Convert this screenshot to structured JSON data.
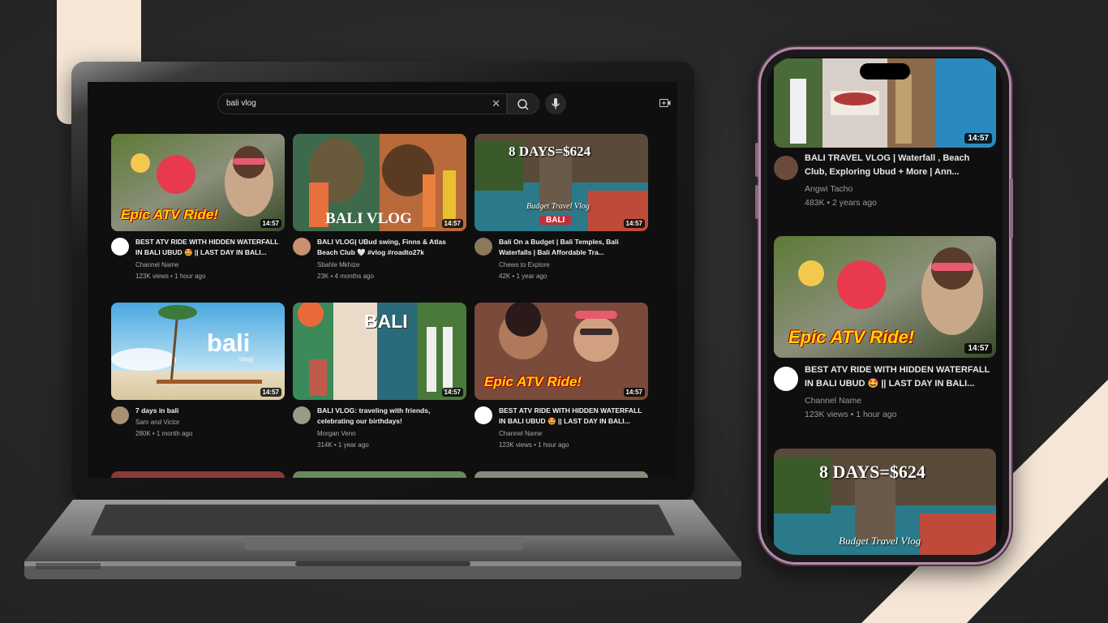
{
  "desktop": {
    "search": {
      "query": "bali vlog"
    },
    "videos": [
      {
        "title": "BEST ATV RIDE WITH HIDDEN WATERFALL IN BALI UBUD 🤩 || LAST DAY IN BALI...",
        "channel": "Channel Name",
        "stats": "123K views • 1 hour ago",
        "duration": "14:57",
        "thumb_text": "Epic ATV Ride!"
      },
      {
        "title": "BALI VLOG| UBud swing, Finns & Atlas Beach Club 🤍 #vlog #roadto27k",
        "channel": "Sbahle Mkhize",
        "stats": "23K • 4 months ago",
        "duration": "14:57",
        "thumb_text": "BALI VLOG"
      },
      {
        "title": "Bali On a Budget | Bali Temples, Bali Waterfalls | Bali Affordable Tra...",
        "channel": "Chews to Explore",
        "stats": "42K • 1 year ago",
        "duration": "14:57",
        "thumb_text": "8 DAYS=$624",
        "thumb_subtext": "Budget Travel Vlog",
        "thumb_badge": "BALI"
      },
      {
        "title": "7 days in bali",
        "channel": "Sam and Victor",
        "stats": "280K • 1 month ago",
        "duration": "14:57",
        "thumb_text": "bali",
        "thumb_subtext": "(vlog)"
      },
      {
        "title": "BALI VLOG: traveling with friends, celebrating our birthdays!",
        "channel": "Morgan Venn",
        "stats": "314K • 1 year ago",
        "duration": "14:57",
        "thumb_text": "BALI"
      },
      {
        "title": "BEST ATV RIDE WITH HIDDEN WATERFALL IN BALI UBUD 🤩 || LAST DAY IN BALI...",
        "channel": "Channel Name",
        "stats": "123K views • 1 hour ago",
        "duration": "14:57",
        "thumb_text": "Epic ATV Ride!"
      }
    ]
  },
  "mobile": {
    "videos": [
      {
        "title": "BALI TRAVEL VLOG | Waterfall , Beach Club, Exploring Ubud + More | Ann...",
        "channel": "Angwi Tacho",
        "stats": "483K • 2 years ago",
        "duration": "14:57"
      },
      {
        "title": "BEST ATV RIDE WITH HIDDEN WATERFALL IN BALI UBUD 🤩 || LAST DAY IN BALI...",
        "channel": "Channel Name",
        "stats": "123K views • 1 hour ago",
        "duration": "14:57",
        "thumb_text": "Epic ATV Ride!"
      },
      {
        "thumb_text": "8 DAYS=$624",
        "thumb_subtext": "Budget Travel Vlog"
      }
    ]
  },
  "colors": {
    "background": "#2b2b2b",
    "accent_cream": "#f5e6d6",
    "phone_frame": "#b58aa8",
    "youtube_bg": "#0f0f0f"
  }
}
